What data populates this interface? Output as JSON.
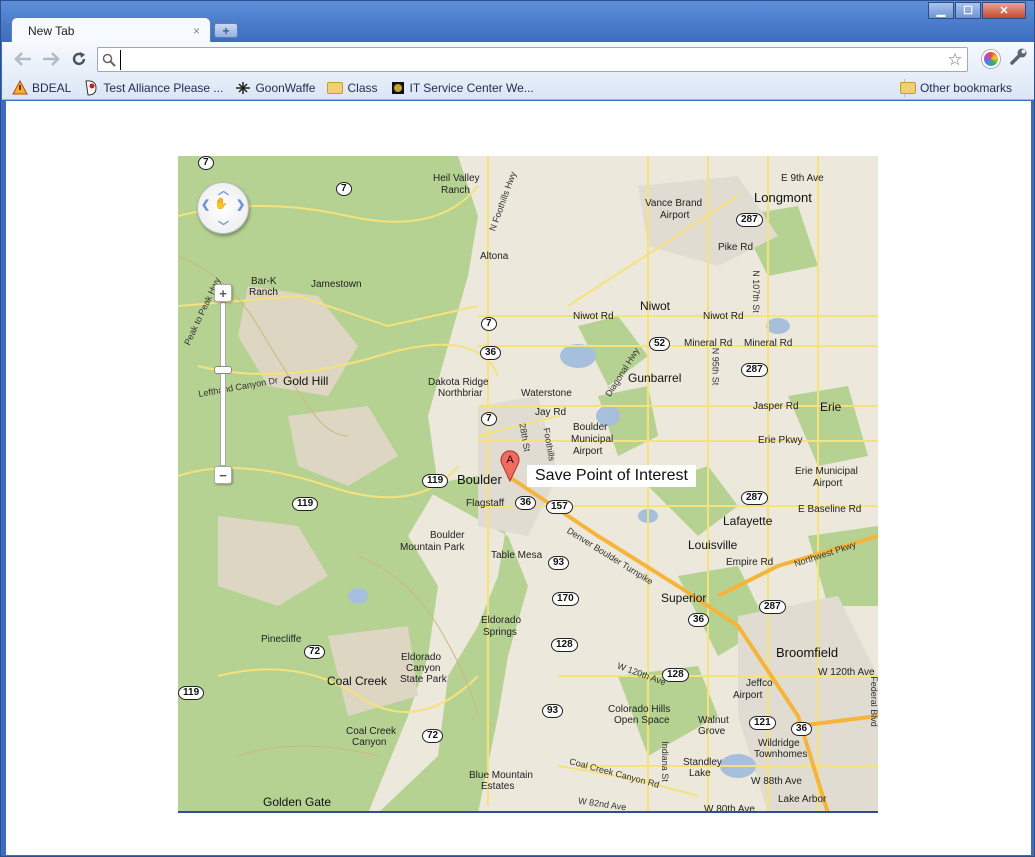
{
  "tab": {
    "title": "New Tab",
    "close": "×",
    "new_tab": "+"
  },
  "window": {
    "minimize": "▁",
    "maximize": "☐",
    "close": "✕"
  },
  "omnibox": {
    "value": "",
    "placeholder": ""
  },
  "bookmarks": {
    "items": [
      {
        "label": "BDEAL",
        "icon": "warning-icon"
      },
      {
        "label": "Test Alliance Please ...",
        "icon": "site-icon"
      },
      {
        "label": "GoonWaffe",
        "icon": "site-icon"
      },
      {
        "label": "Class",
        "icon": "folder-icon"
      },
      {
        "label": "IT Service Center We...",
        "icon": "site-icon"
      }
    ],
    "other": "Other bookmarks"
  },
  "map": {
    "poi_label": "Save Point of Interest",
    "marker_letter": "A",
    "places": {
      "longmont": "Longmont",
      "vance_brand": "Vance Brand",
      "vance_airport": "Airport",
      "heil_valley": "Heil Valley",
      "heil_ranch": "Ranch",
      "jamestown": "Jamestown",
      "bar_k": "Bar-K",
      "bar_k_ranch": "Ranch",
      "altona": "Altona",
      "niwot": "Niwot",
      "gold_hill": "Gold Hill",
      "dakota_ridge": "Dakota Ridge",
      "northbriar": "Northbriar",
      "waterstone": "Waterstone",
      "gunbarrel": "Gunbarrel",
      "boulder": "Boulder",
      "boulder_muni": "Boulder",
      "boulder_muni2": "Municipal",
      "boulder_muni3": "Airport",
      "flagstaff": "Flagstaff",
      "erie": "Erie",
      "erie_muni": "Erie Municipal",
      "erie_airport": "Airport",
      "lafayette": "Lafayette",
      "louisville": "Louisville",
      "boulder_mtn_park": "Boulder",
      "boulder_mtn_park2": "Mountain Park",
      "table_mesa": "Table Mesa",
      "superior": "Superior",
      "eldorado": "Eldorado",
      "eldorado_springs": "Springs",
      "pinecliffe": "Pinecliffe",
      "eldorado_canyon": "Eldorado",
      "eldorado_canyon2": "Canyon",
      "eldorado_canyon3": "State Park",
      "coal_creek": "Coal Creek",
      "coal_creek_canyon": "Coal Creek",
      "coal_creek_canyon2": "Canyon",
      "broomfield": "Broomfield",
      "jeffco": "Jeffco",
      "jeffco_airport": "Airport",
      "colorado_hills": "Colorado Hills",
      "open_space": "Open Space",
      "walnut_grove": "Walnut",
      "walnut_grove2": "Grove",
      "standley": "Standley",
      "standley2": "Lake",
      "wildridge": "Wildridge",
      "townhomes": "Townhomes",
      "lake_arbor": "Lake Arbor",
      "blue_mountain": "Blue Mountain",
      "estates": "Estates",
      "golden_gate": "Golden Gate",
      "pike_rd": "Pike Rd",
      "e9th": "E 9th Ave",
      "niwot_rd": "Niwot Rd",
      "niwot_rd2": "Niwot Rd",
      "mineral_rd": "Mineral Rd",
      "mineral_rd2": "Mineral Rd",
      "jasper_rd": "Jasper Rd",
      "jay_rd": "Jay Rd",
      "erie_pkwy": "Erie Pkwy",
      "e_baseline": "E Baseline Rd",
      "empire_rd": "Empire Rd",
      "northwest_pkwy": "Northwest Pkwy",
      "w120th": "W 120th Ave",
      "w120th2": "W 120th Ave",
      "w88th": "W 88th Ave",
      "w82nd": "W 82nd Ave",
      "w80th": "W 80th Ave",
      "diagonal": "Diagonal Hwy",
      "denver_boulder": "Denver Boulder Turnpike",
      "coal_creek_cyn_rd": "Coal Creek Canyon Rd",
      "n_foothills": "N Foothills Hwy",
      "lefthand": "Lefthand Canyon Dr",
      "peak_to_peak": "Peak to Peak Hwy",
      "foothills": "Foothills",
      "st28": "28th St",
      "n95th": "N 95th St",
      "n107th": "N 107th St",
      "indiana": "Indiana St",
      "federal": "Federal Blvd"
    },
    "shields": [
      "7",
      "7",
      "7",
      "7",
      "36",
      "36",
      "36",
      "36",
      "52",
      "287",
      "287",
      "287",
      "287",
      "119",
      "119",
      "119",
      "157",
      "93",
      "93",
      "170",
      "128",
      "128",
      "72",
      "72",
      "121"
    ]
  }
}
